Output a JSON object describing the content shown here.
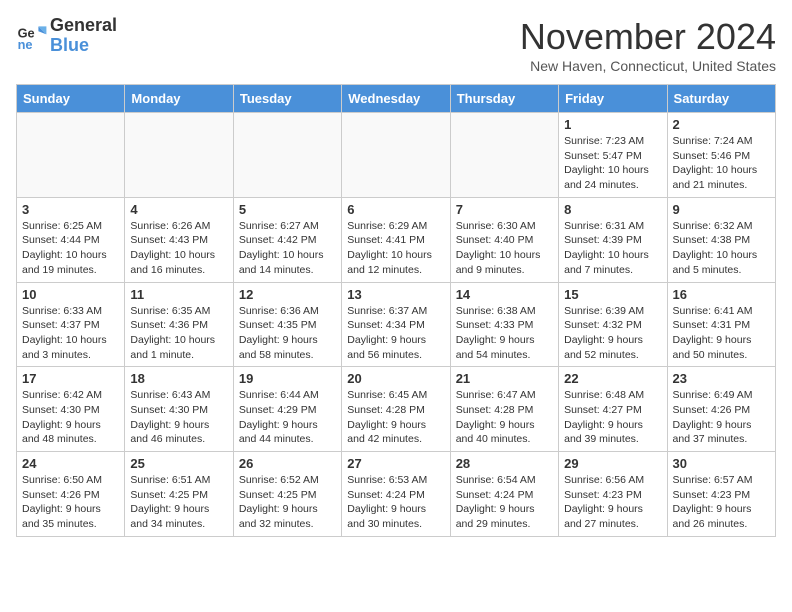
{
  "logo": {
    "general": "General",
    "blue": "Blue"
  },
  "title": "November 2024",
  "location": "New Haven, Connecticut, United States",
  "weekdays": [
    "Sunday",
    "Monday",
    "Tuesday",
    "Wednesday",
    "Thursday",
    "Friday",
    "Saturday"
  ],
  "weeks": [
    [
      {
        "day": "",
        "info": ""
      },
      {
        "day": "",
        "info": ""
      },
      {
        "day": "",
        "info": ""
      },
      {
        "day": "",
        "info": ""
      },
      {
        "day": "",
        "info": ""
      },
      {
        "day": "1",
        "info": "Sunrise: 7:23 AM\nSunset: 5:47 PM\nDaylight: 10 hours and 24 minutes."
      },
      {
        "day": "2",
        "info": "Sunrise: 7:24 AM\nSunset: 5:46 PM\nDaylight: 10 hours and 21 minutes."
      }
    ],
    [
      {
        "day": "3",
        "info": "Sunrise: 6:25 AM\nSunset: 4:44 PM\nDaylight: 10 hours and 19 minutes."
      },
      {
        "day": "4",
        "info": "Sunrise: 6:26 AM\nSunset: 4:43 PM\nDaylight: 10 hours and 16 minutes."
      },
      {
        "day": "5",
        "info": "Sunrise: 6:27 AM\nSunset: 4:42 PM\nDaylight: 10 hours and 14 minutes."
      },
      {
        "day": "6",
        "info": "Sunrise: 6:29 AM\nSunset: 4:41 PM\nDaylight: 10 hours and 12 minutes."
      },
      {
        "day": "7",
        "info": "Sunrise: 6:30 AM\nSunset: 4:40 PM\nDaylight: 10 hours and 9 minutes."
      },
      {
        "day": "8",
        "info": "Sunrise: 6:31 AM\nSunset: 4:39 PM\nDaylight: 10 hours and 7 minutes."
      },
      {
        "day": "9",
        "info": "Sunrise: 6:32 AM\nSunset: 4:38 PM\nDaylight: 10 hours and 5 minutes."
      }
    ],
    [
      {
        "day": "10",
        "info": "Sunrise: 6:33 AM\nSunset: 4:37 PM\nDaylight: 10 hours and 3 minutes."
      },
      {
        "day": "11",
        "info": "Sunrise: 6:35 AM\nSunset: 4:36 PM\nDaylight: 10 hours and 1 minute."
      },
      {
        "day": "12",
        "info": "Sunrise: 6:36 AM\nSunset: 4:35 PM\nDaylight: 9 hours and 58 minutes."
      },
      {
        "day": "13",
        "info": "Sunrise: 6:37 AM\nSunset: 4:34 PM\nDaylight: 9 hours and 56 minutes."
      },
      {
        "day": "14",
        "info": "Sunrise: 6:38 AM\nSunset: 4:33 PM\nDaylight: 9 hours and 54 minutes."
      },
      {
        "day": "15",
        "info": "Sunrise: 6:39 AM\nSunset: 4:32 PM\nDaylight: 9 hours and 52 minutes."
      },
      {
        "day": "16",
        "info": "Sunrise: 6:41 AM\nSunset: 4:31 PM\nDaylight: 9 hours and 50 minutes."
      }
    ],
    [
      {
        "day": "17",
        "info": "Sunrise: 6:42 AM\nSunset: 4:30 PM\nDaylight: 9 hours and 48 minutes."
      },
      {
        "day": "18",
        "info": "Sunrise: 6:43 AM\nSunset: 4:30 PM\nDaylight: 9 hours and 46 minutes."
      },
      {
        "day": "19",
        "info": "Sunrise: 6:44 AM\nSunset: 4:29 PM\nDaylight: 9 hours and 44 minutes."
      },
      {
        "day": "20",
        "info": "Sunrise: 6:45 AM\nSunset: 4:28 PM\nDaylight: 9 hours and 42 minutes."
      },
      {
        "day": "21",
        "info": "Sunrise: 6:47 AM\nSunset: 4:28 PM\nDaylight: 9 hours and 40 minutes."
      },
      {
        "day": "22",
        "info": "Sunrise: 6:48 AM\nSunset: 4:27 PM\nDaylight: 9 hours and 39 minutes."
      },
      {
        "day": "23",
        "info": "Sunrise: 6:49 AM\nSunset: 4:26 PM\nDaylight: 9 hours and 37 minutes."
      }
    ],
    [
      {
        "day": "24",
        "info": "Sunrise: 6:50 AM\nSunset: 4:26 PM\nDaylight: 9 hours and 35 minutes."
      },
      {
        "day": "25",
        "info": "Sunrise: 6:51 AM\nSunset: 4:25 PM\nDaylight: 9 hours and 34 minutes."
      },
      {
        "day": "26",
        "info": "Sunrise: 6:52 AM\nSunset: 4:25 PM\nDaylight: 9 hours and 32 minutes."
      },
      {
        "day": "27",
        "info": "Sunrise: 6:53 AM\nSunset: 4:24 PM\nDaylight: 9 hours and 30 minutes."
      },
      {
        "day": "28",
        "info": "Sunrise: 6:54 AM\nSunset: 4:24 PM\nDaylight: 9 hours and 29 minutes."
      },
      {
        "day": "29",
        "info": "Sunrise: 6:56 AM\nSunset: 4:23 PM\nDaylight: 9 hours and 27 minutes."
      },
      {
        "day": "30",
        "info": "Sunrise: 6:57 AM\nSunset: 4:23 PM\nDaylight: 9 hours and 26 minutes."
      }
    ]
  ]
}
